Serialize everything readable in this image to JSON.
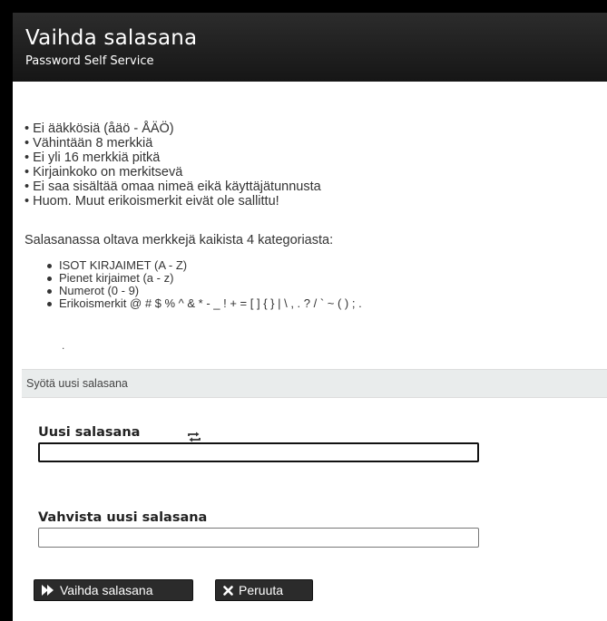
{
  "header": {
    "title": "Vaihda salasana",
    "subtitle": "Password Self Service"
  },
  "rules": [
    "• Ei ääkkösiä (åäö - ÅÄÖ)",
    "• Vähintään 8 merkkiä",
    "• Ei yli 16 merkkiä pitkä",
    "• Kirjainkoko on merkitsevä",
    "• Ei saa sisältää omaa nimeä eikä käyttäjätunnusta",
    "• Huom. Muut erikoismerkit eivät ole sallittu!"
  ],
  "categories_intro": "Salasanassa oltava merkkejä kaikista 4 kategoriasta:",
  "categories": [
    "ISOT KIRJAIMET (A - Z)",
    "Pienet kirjaimet (a - z)",
    "Numerot (0 - 9)",
    "Erikoismerkit @ # $ % ^ & * - _ ! + = [ ] { } | \\ , . ? / ` ~ ( ) ; ."
  ],
  "stray_dot": ".",
  "section": {
    "label": "Syötä uusi salasana"
  },
  "new_password": {
    "label": "Uusi salasana",
    "value": "",
    "toggle_icon": "refresh-icon"
  },
  "confirm_password": {
    "label": "Vahvista uusi salasana",
    "value": ""
  },
  "buttons": {
    "submit_label": "Vaihda salasana",
    "submit_icon": "fast-forward-icon",
    "cancel_label": "Peruuta",
    "cancel_icon": "close-icon"
  },
  "colors": {
    "header_bg": "#1e1e1e",
    "button_bg": "#2b2b2b",
    "section_bg": "#e9ecec",
    "text": "#333333"
  }
}
